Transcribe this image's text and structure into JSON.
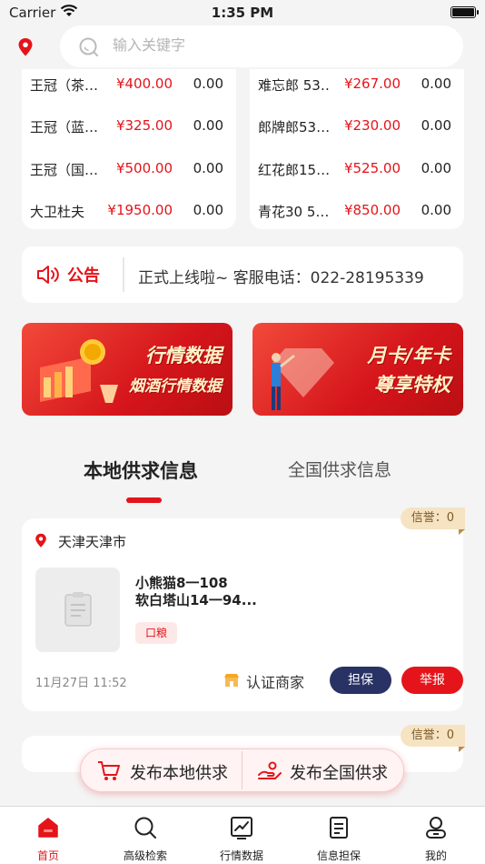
{
  "status_bar": {
    "carrier": "Carrier",
    "time": "1:35 PM"
  },
  "search": {
    "placeholder": "输入关键字"
  },
  "price_lists": {
    "left": [
      {
        "name": "王冠（茶…",
        "price": "¥400.00",
        "change": "0.00"
      },
      {
        "name": "王冠（蓝…",
        "price": "¥325.00",
        "change": "0.00"
      },
      {
        "name": "王冠（国…",
        "price": "¥500.00",
        "change": "0.00"
      },
      {
        "name": "大卫杜夫",
        "price": "¥1950.00",
        "change": "0.00"
      }
    ],
    "right": [
      {
        "name": "难忘郎 53…",
        "price": "¥267.00",
        "change": "0.00"
      },
      {
        "name": "郎牌郎53…",
        "price": "¥230.00",
        "change": "0.00"
      },
      {
        "name": "红花郎15…",
        "price": "¥525.00",
        "change": "0.00"
      },
      {
        "name": "青花30 5…",
        "price": "¥850.00",
        "change": "0.00"
      }
    ]
  },
  "notice": {
    "title": "公告",
    "message": "正式上线啦~   客服电话：022-28195339"
  },
  "banners": {
    "market": {
      "line1": "行情数据",
      "line2": "烟酒行情数据"
    },
    "vip": {
      "line1": "月卡/年卡",
      "line2": "尊享特权"
    }
  },
  "tabs": {
    "local": "本地供求信息",
    "national": "全国供求信息"
  },
  "posts": [
    {
      "credit": "信誉：0",
      "city": "天津天津市",
      "title": "小熊猫8一108\n软白塔山14一94...",
      "tag": "口粮",
      "date": "11月27日 11:52",
      "merchant": "认证商家",
      "guarantee": "担保",
      "report": "举报"
    },
    {
      "credit": "信誉：0"
    }
  ],
  "publish": {
    "local": "发布本地供求",
    "national": "发布全国供求"
  },
  "tabbar": [
    {
      "label": "首页",
      "icon": "home-icon"
    },
    {
      "label": "高级检索",
      "icon": "search-icon"
    },
    {
      "label": "行情数据",
      "icon": "chart-icon"
    },
    {
      "label": "信息担保",
      "icon": "document-icon"
    },
    {
      "label": "我的",
      "icon": "user-icon"
    }
  ],
  "colors": {
    "accent": "#e4141a",
    "navy": "#283264",
    "gold": "#f6e3c2"
  }
}
